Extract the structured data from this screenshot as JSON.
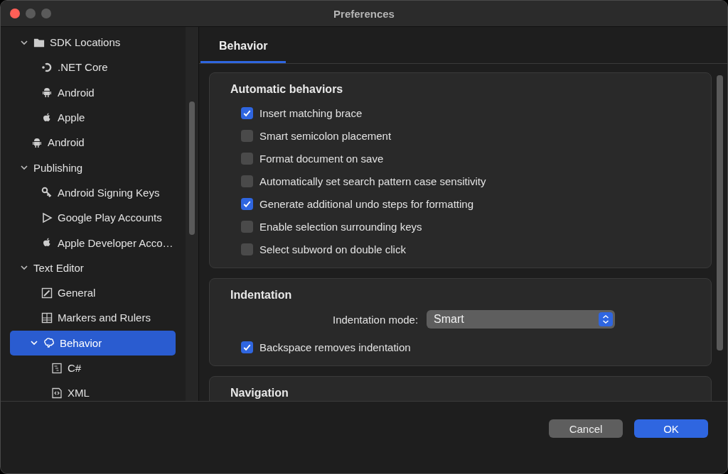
{
  "window": {
    "title": "Preferences"
  },
  "sidebar": {
    "items": [
      {
        "label": "SDK Locations",
        "expanded": true,
        "selected": false,
        "children": [
          {
            "label": ".NET Core",
            "selected": false
          },
          {
            "label": "Android",
            "selected": false
          },
          {
            "label": "Apple",
            "selected": false
          }
        ]
      },
      {
        "label": "Android",
        "selected": false
      },
      {
        "label": "Publishing",
        "expanded": true,
        "selected": false,
        "children": [
          {
            "label": "Android Signing Keys",
            "selected": false
          },
          {
            "label": "Google Play Accounts",
            "selected": false
          },
          {
            "label": "Apple Developer Acco…",
            "selected": false
          }
        ]
      },
      {
        "label": "Text Editor",
        "expanded": true,
        "selected": false,
        "children": [
          {
            "label": "General",
            "selected": false
          },
          {
            "label": "Markers and Rulers",
            "selected": false
          },
          {
            "label": "Behavior",
            "expanded": true,
            "selected": true,
            "children": [
              {
                "label": "C#",
                "selected": false
              },
              {
                "label": "XML",
                "selected": false
              }
            ]
          }
        ]
      }
    ]
  },
  "tabs": [
    {
      "label": "Behavior",
      "selected": true
    }
  ],
  "sections": [
    {
      "title": "Automatic behaviors",
      "options": [
        {
          "label": "Insert matching brace",
          "checked": true
        },
        {
          "label": "Smart semicolon placement",
          "checked": false
        },
        {
          "label": "Format document on save",
          "checked": false
        },
        {
          "label": "Automatically set search pattern case sensitivity",
          "checked": false
        },
        {
          "label": "Generate additional undo steps for formatting",
          "checked": true
        },
        {
          "label": "Enable selection surrounding keys",
          "checked": false
        },
        {
          "label": "Select subword on double click",
          "checked": false
        }
      ]
    },
    {
      "title": "Indentation",
      "select": {
        "label": "Indentation mode:",
        "value": "Smart"
      },
      "options": [
        {
          "label": "Backspace removes indentation",
          "checked": true
        }
      ]
    },
    {
      "title": "Navigation"
    }
  ],
  "buttons": [
    {
      "label": "Cancel",
      "default": false
    },
    {
      "label": "OK",
      "default": true
    }
  ]
}
